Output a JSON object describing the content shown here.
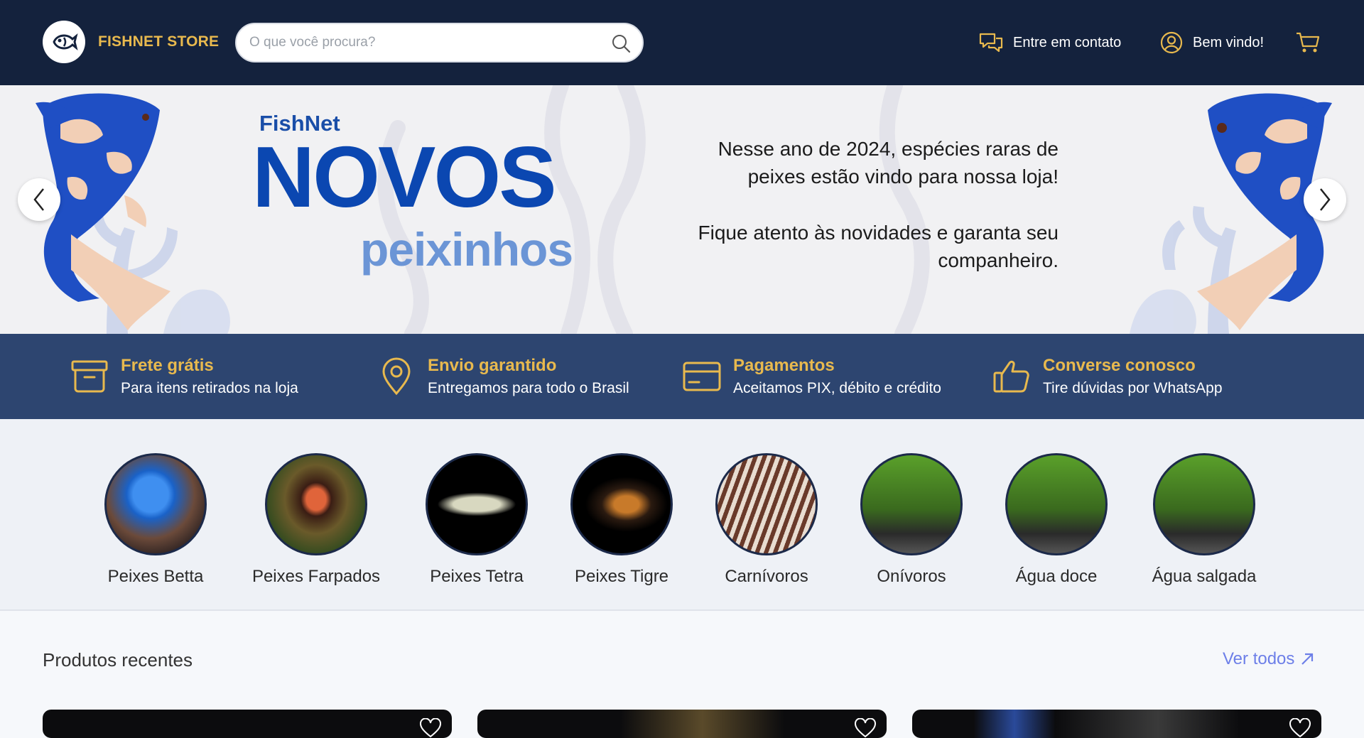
{
  "header": {
    "brand": "FISHNET STORE",
    "search_placeholder": "O que você procura?",
    "contact_label": "Entre em contato",
    "welcome_label": "Bem vindo!",
    "colors": {
      "background": "#14223d",
      "accent": "#e8b94e"
    }
  },
  "banner": {
    "brand": "FishNet",
    "title": "NOVOS",
    "subtitle": "peixinhos",
    "text_1": "Nesse ano de 2024, espécies raras de peixes estão vindo para nossa loja!",
    "text_2": "Fique atento às novidades e garanta seu companheiro."
  },
  "features": [
    {
      "title": "Frete grátis",
      "desc": "Para itens retirados na loja",
      "icon": "box-icon"
    },
    {
      "title": "Envio garantido",
      "desc": "Entregamos para todo o Brasil",
      "icon": "location-pin-icon"
    },
    {
      "title": "Pagamentos",
      "desc": "Aceitamos PIX, débito e crédito",
      "icon": "credit-card-icon"
    },
    {
      "title": "Converse conosco",
      "desc": "Tire dúvidas por WhatsApp",
      "icon": "thumbs-up-icon"
    }
  ],
  "categories": [
    {
      "label": "Peixes Betta"
    },
    {
      "label": "Peixes Farpados"
    },
    {
      "label": "Peixes Tetra"
    },
    {
      "label": "Peixes Tigre"
    },
    {
      "label": "Carnívoros"
    },
    {
      "label": "Onívoros"
    },
    {
      "label": "Água doce"
    },
    {
      "label": "Água salgada"
    }
  ],
  "recent": {
    "title": "Produtos recentes",
    "see_all": "Ver todos"
  }
}
